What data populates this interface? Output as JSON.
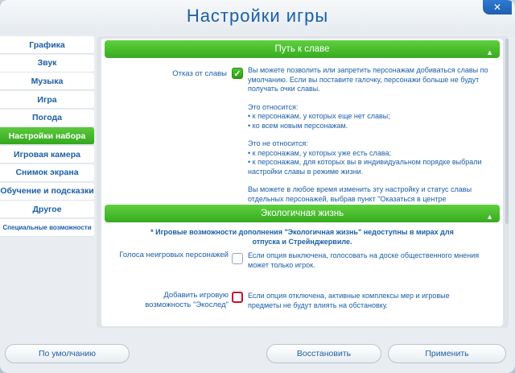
{
  "window": {
    "title": "Настройки игры",
    "close_label": "✕"
  },
  "sidebar": {
    "items": [
      {
        "label": "Графика"
      },
      {
        "label": "Звук"
      },
      {
        "label": "Музыка"
      },
      {
        "label": "Игра"
      },
      {
        "label": "Погода"
      },
      {
        "label": "Настройки набора",
        "active": true
      },
      {
        "label": "Игровая камера"
      },
      {
        "label": "Снимок экрана"
      },
      {
        "label": "Обучение и подсказки"
      },
      {
        "label": "Другое"
      },
      {
        "label": "Специальные возможности"
      }
    ]
  },
  "fame": {
    "header": "Путь к славе",
    "toggle_icon": "▲",
    "option_label": "Отказ от славы",
    "checked": true,
    "desc_1": "Вы можете позволить или запретить персонажам добиваться славы по умолчанию. Если вы поставите галочку, персонажи больше не будут получать очки славы.",
    "applies_title": "Это относится:",
    "applies_1": "• к персонажам, у которых еще нет славы;",
    "applies_2": "• ко всем новым персонажам.",
    "not_applies_title": "Это не относится:",
    "not_applies_1": "• к персонажам, у которых уже есть слава;",
    "not_applies_2": "• к персонажам, для которых вы в индивидуальном порядке выбрали настройки славы в режиме жизни.",
    "desc_2": "Вы можете в любое время изменить эту настройку и статус славы отдельных персонажей, выбрав пункт \"Оказаться в центре"
  },
  "eco": {
    "header": "Экологичная жизнь",
    "toggle_icon": "▲",
    "notice": "* Игровые возможности дополнения \"Экологичная жизнь\" недоступны в мирах для отпуска и Стрейнджервиле.",
    "vote_label": "Голоса неигровых персонажей",
    "vote_desc": "Если опция выключена, голосовать на доске общественного мнения может только игрок.",
    "vote_checked": false,
    "eco_label": "Добавить игровую возможность \"Экослед\"",
    "eco_desc": "Если опция отключена, активные комплексы мер и игровые предметы не будут влиять на обстановку.",
    "eco_checked": false
  },
  "footer": {
    "default_label": "По умолчанию",
    "restore_label": "Восстановить",
    "apply_label": "Применить"
  }
}
